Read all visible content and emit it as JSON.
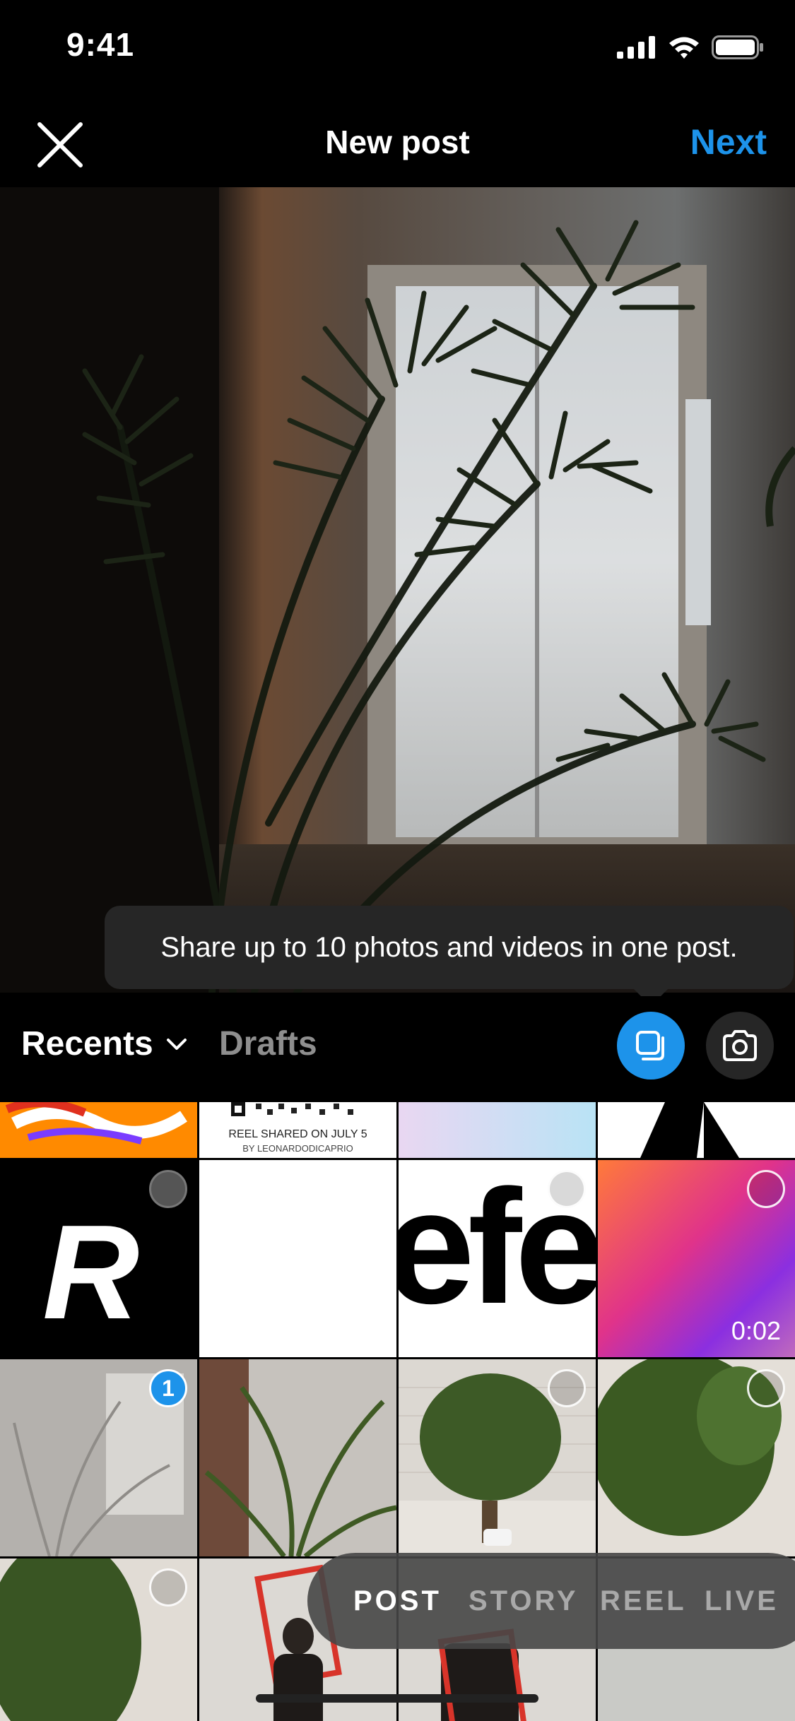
{
  "status": {
    "time": "9:41"
  },
  "header": {
    "title": "New post",
    "next_label": "Next"
  },
  "tooltip": {
    "text": "Share up to 10 photos and videos in one post."
  },
  "selector": {
    "album_label": "Recents",
    "drafts_label": "Drafts"
  },
  "grid": {
    "reel_caption": "REEL SHARED ON JULY 5",
    "reel_byline": "BY LEONARDODICAPRIO",
    "tile_letter": "R",
    "tile_word": "efe",
    "video_duration": "0:02",
    "selected_count": "1"
  },
  "modes": {
    "post": "POST",
    "story": "STORY",
    "reel": "REEL",
    "live": "LIVE"
  },
  "colors": {
    "accent": "#1d93ea",
    "background": "#000000",
    "tooltip": "#262626"
  }
}
